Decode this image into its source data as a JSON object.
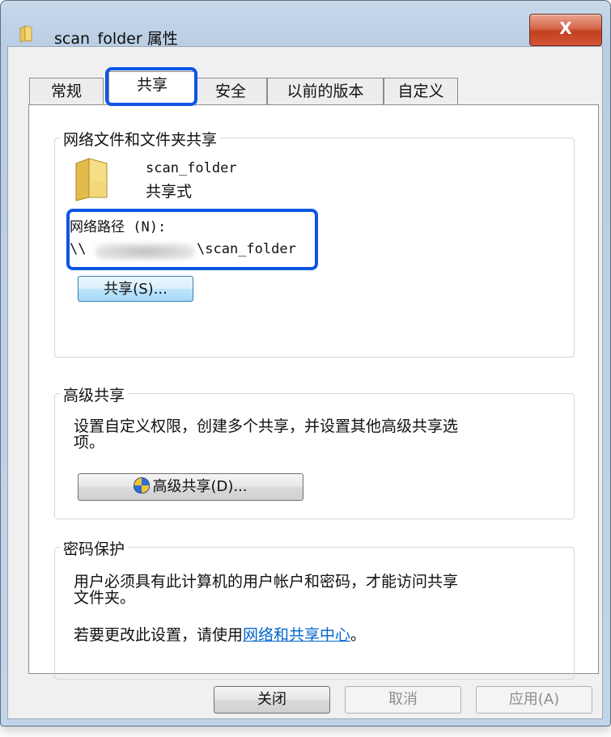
{
  "window": {
    "title": "scan_folder 属性",
    "close_glyph": "X"
  },
  "tabs": [
    {
      "label": "常规"
    },
    {
      "label": "共享"
    },
    {
      "label": "安全"
    },
    {
      "label": "以前的版本"
    },
    {
      "label": "自定义"
    }
  ],
  "network_sharing": {
    "group_label": "网络文件和文件夹共享",
    "folder_name": "scan_folder",
    "share_status": "共享式",
    "path_label": "网络路径 (N):",
    "path_prefix": "\\\\",
    "path_suffix": "\\scan_folder",
    "share_button": "共享(S)..."
  },
  "advanced_sharing": {
    "group_label": "高级共享",
    "description_line1": "设置自定义权限，创建多个共享，并设置其他高级共享选",
    "description_line2": "项。",
    "button": "高级共享(D)..."
  },
  "password_protection": {
    "group_label": "密码保护",
    "description_line1": "用户必须具有此计算机的用户帐户和密码，才能访问共享",
    "description_line2": "文件夹。",
    "change_prefix": "若要更改此设置，请使用",
    "link_text": "网络和共享中心",
    "change_suffix": "。"
  },
  "footer": {
    "close": "关闭",
    "cancel": "取消",
    "apply": "应用(A)"
  },
  "colors": {
    "highlight": "#0d56e3",
    "link": "#0066cc"
  }
}
